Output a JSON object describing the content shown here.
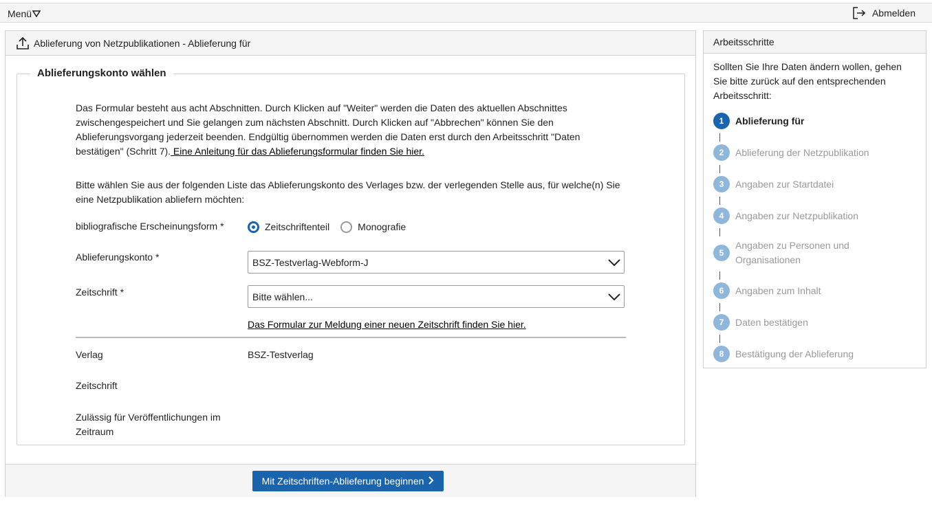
{
  "topbar": {
    "menu_label": "Menü",
    "logout_label": "Abmelden"
  },
  "main": {
    "title": "Ablieferung von Netzpublikationen - Ablieferung für",
    "legend": "Ablieferungskonto wählen",
    "intro_text": "Das Formular besteht aus acht Abschnitten. Durch Klicken auf \"Weiter\" werden die Daten des aktuellen Abschnittes zwischengespeichert und Sie gelangen zum nächsten Abschnitt. Durch Klicken auf \"Abbrechen\" können Sie den Ablieferungsvorgang jederzeit beenden. Endgültig übernommen werden die Daten erst durch den Arbeitsschritt \"Daten bestätigen\" (Schritt 7).",
    "intro_link": " Eine Anleitung für das Ablieferungsformular finden Sie hier.",
    "choose_text": "Bitte wählen Sie aus der folgenden Liste das Ablieferungskonto des Verlages bzw. der verlegenden Stelle aus, für welche(n) Sie eine Netzpublikation abliefern möchten:",
    "form_label": "bibliografische Erscheinungsform *",
    "radio_1": "Zeitschriftenteil",
    "radio_2": "Monografie",
    "account_label": "Ablieferungskonto *",
    "account_value": "BSZ-Testverlag-Webform-J",
    "journal_label": "Zeitschrift *",
    "journal_value": "Bitte wählen...",
    "new_journal_link": "Das Formular zur Meldung einer neuen Zeitschrift finden Sie hier.",
    "publisher_label": "Verlag",
    "publisher_value": "BSZ-Testverlag",
    "journal_info_label": "Zeitschrift",
    "period_label": "Zulässig für Veröffentlichungen im Zeitraum",
    "start_button": "Mit Zeitschriften-Ablieferung beginnen"
  },
  "side": {
    "title": "Arbeitsschritte",
    "intro": "Sollten Sie Ihre Daten ändern wollen, gehen Sie bitte zurück auf den entsprechenden Arbeitsschritt:",
    "steps": [
      {
        "num": "1",
        "label": "Ablieferung für"
      },
      {
        "num": "2",
        "label": "Ablieferung der Netzpublikation"
      },
      {
        "num": "3",
        "label": "Angaben zur Startdatei"
      },
      {
        "num": "4",
        "label": "Angaben zur Netzpublikation"
      },
      {
        "num": "5",
        "label": "Angaben zu Personen und Organisationen"
      },
      {
        "num": "6",
        "label": "Angaben zum Inhalt"
      },
      {
        "num": "7",
        "label": "Daten bestätigen"
      },
      {
        "num": "8",
        "label": "Bestätigung der Ablieferung"
      }
    ]
  },
  "colors": {
    "accent": "#1a63ad",
    "step_inactive": "#8fb7dc"
  }
}
